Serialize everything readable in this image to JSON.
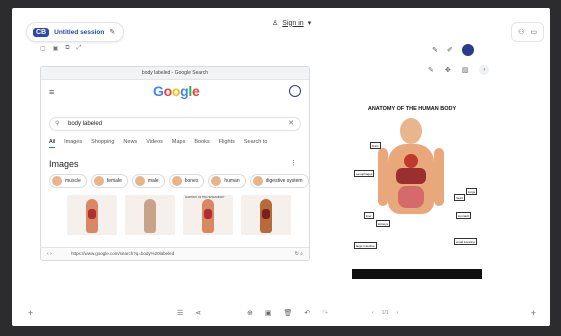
{
  "session": {
    "logo": "CB",
    "title": "Untitled session"
  },
  "header": {
    "sign_in": "Sign in",
    "sign_in_caret": "▾"
  },
  "browser": {
    "tab_title": "body labeled - Google Search",
    "logo": "Google",
    "search_value": "body labeled",
    "tabs": [
      "All",
      "Images",
      "Shopping",
      "News",
      "Videos",
      "Maps",
      "Books",
      "Flights",
      "Search to"
    ],
    "images_heading": "Images",
    "chips": [
      "muscle",
      "female",
      "male",
      "bones",
      "human",
      "digestive system"
    ],
    "thumb_caption": "ANATOMY OF THE HUMAN BODY",
    "url": "https://www.google.com/search?q=body%20labeled"
  },
  "anatomy": {
    "title": "ANATOMY OF THE HUMAN BODY",
    "labels": [
      "brain",
      "oesophagus",
      "lungs",
      "heart",
      "liver",
      "stomach",
      "kidneys",
      "large intestine",
      "small intestine"
    ]
  },
  "pager": {
    "text": "1/1"
  },
  "colors": {
    "accent": "#2b4aa8",
    "google_blue": "#4285f4",
    "google_red": "#ea4335",
    "google_yellow": "#fbbc05",
    "google_green": "#34a853"
  }
}
